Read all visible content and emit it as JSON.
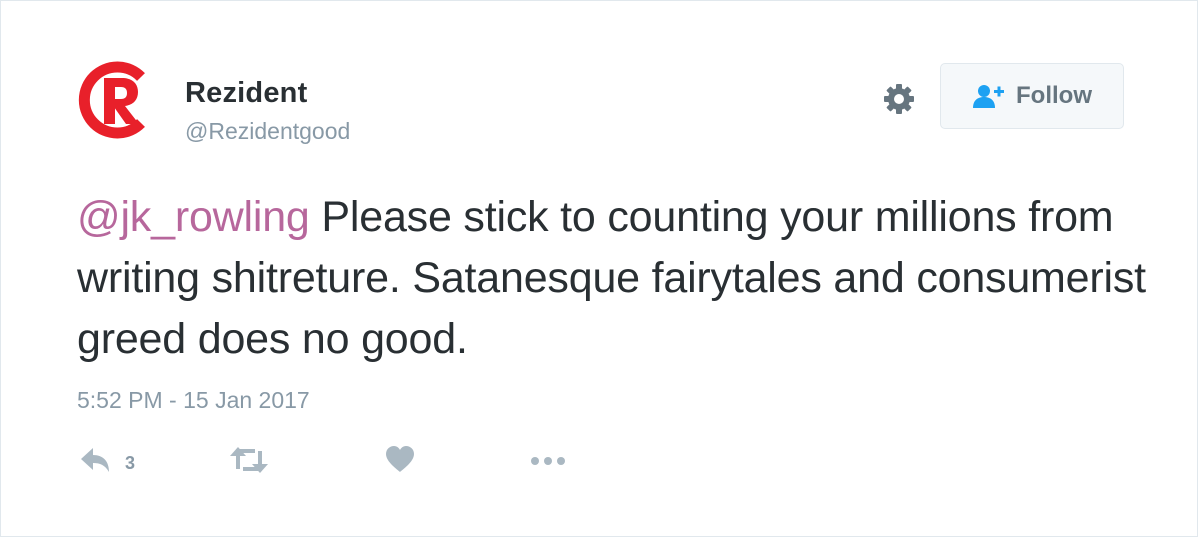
{
  "tweet": {
    "author": {
      "display_name": "Rezident",
      "username": "@Rezidentgood",
      "avatar_icon": "registered-r-logo-icon",
      "avatar_color": "#e8202a"
    },
    "header_actions": {
      "settings_icon": "gear-icon",
      "follow_icon": "add-user-icon",
      "follow_label": "Follow"
    },
    "text": {
      "mention": "@jk_rowling",
      "body": " Please stick to counting your millions from writing shitreture. Satanesque fairytales and consumerist greed does no good."
    },
    "timestamp": "5:52 PM - 15 Jan 2017",
    "actions": {
      "reply_icon": "reply-icon",
      "reply_count": "3",
      "retweet_icon": "retweet-icon",
      "like_icon": "heart-icon",
      "more_icon": "more-dots-icon"
    },
    "colors": {
      "mention": "#b7679c",
      "follow_icon": "#1da1f2",
      "muted": "#8899a6",
      "text": "#292f33"
    }
  }
}
